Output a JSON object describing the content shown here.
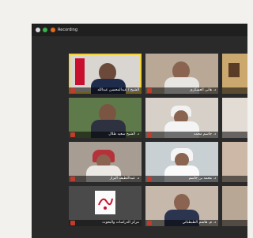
{
  "window": {
    "status_label": "Recording"
  },
  "participants": [
    {
      "name": "الشيخ / عبدالمحسن عبدالله"
    },
    {
      "name": "د. هاني العسكري"
    },
    {
      "name": ""
    },
    {
      "name": "د. الشيخ سعيد طلال"
    },
    {
      "name": "د. جاسم محمد"
    },
    {
      "name": ""
    },
    {
      "name": "د. عبداللطيف البزاز"
    },
    {
      "name": "د. محمد بن جاسم"
    },
    {
      "name": ""
    },
    {
      "name": "مركز الدراسات والبحوث"
    },
    {
      "name": "د. م. هاشم الطبطبائي"
    },
    {
      "name": ""
    }
  ],
  "colors": {
    "active_border": "#f2d23a",
    "rec_dot": "#e36b1d"
  }
}
